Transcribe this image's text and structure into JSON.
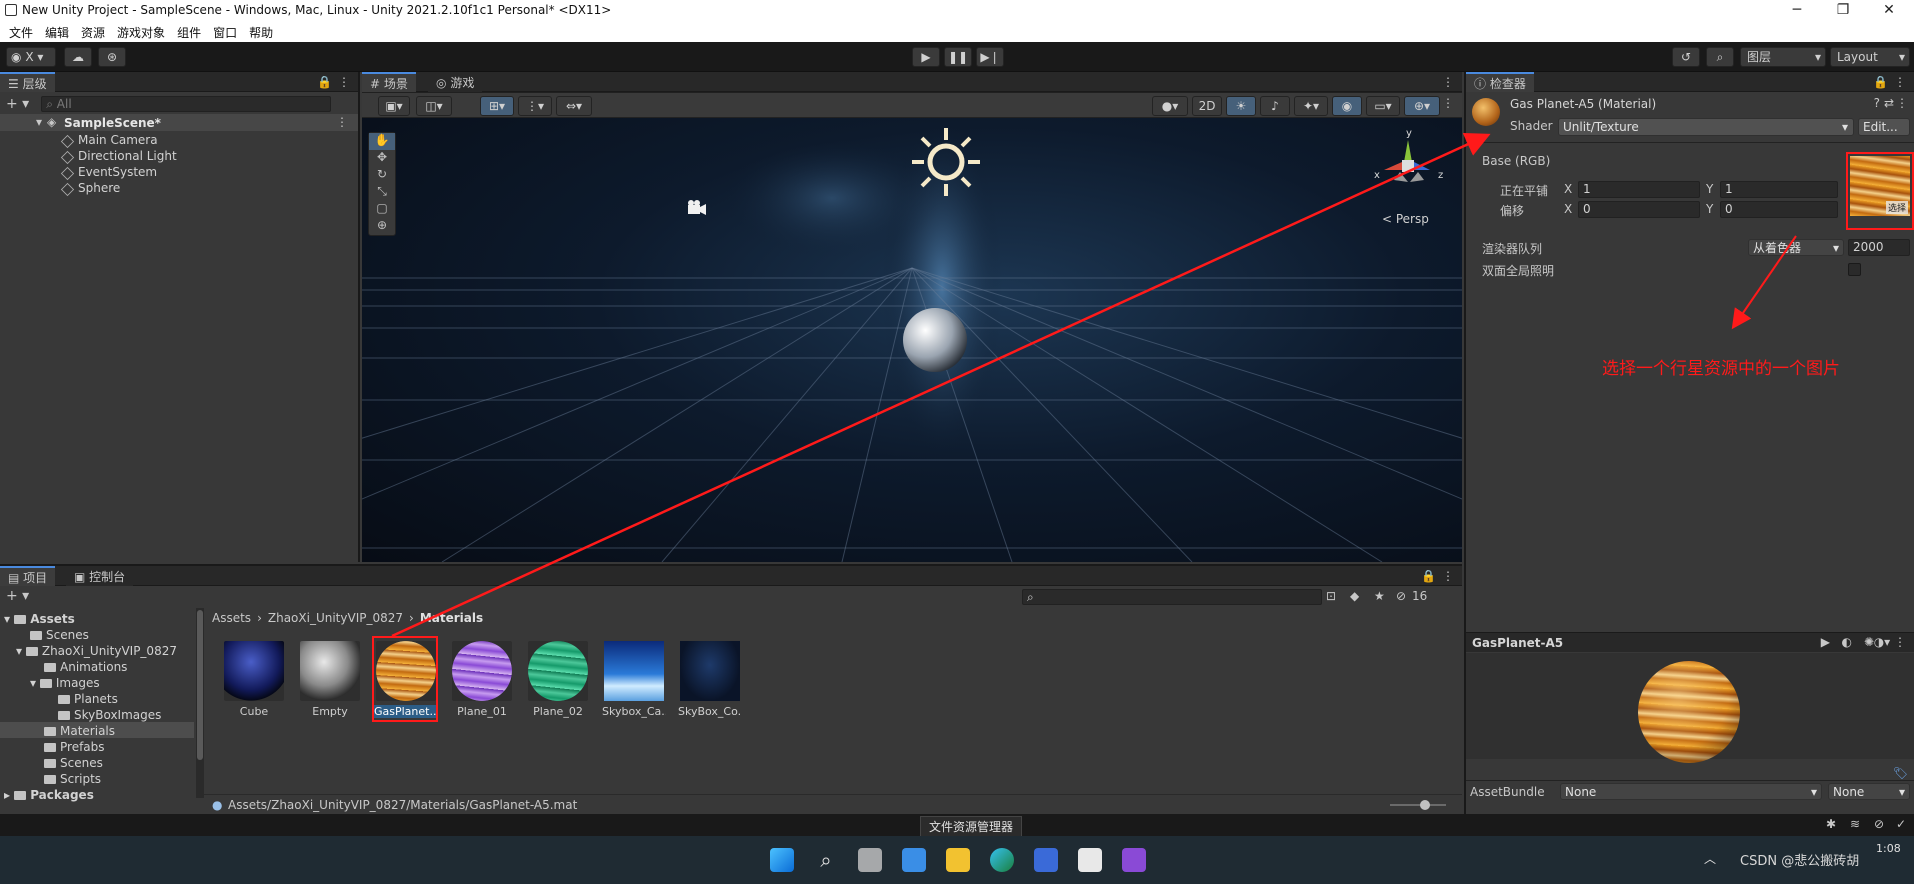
{
  "window": {
    "title": "New Unity Project - SampleScene - Windows, Mac, Linux - Unity 2021.2.10f1c1 Personal* <DX11>",
    "minimize": "─",
    "maximize": "❐",
    "close": "✕"
  },
  "menu": [
    "文件",
    "编辑",
    "资源",
    "游戏对象",
    "组件",
    "窗口",
    "帮助"
  ],
  "toolbar": {
    "account": "X",
    "layers": "图层",
    "layout": "Layout"
  },
  "hierarchy": {
    "tab": "层级",
    "search_placeholder": "All",
    "scene": "SampleScene*",
    "items": [
      "Main Camera",
      "Directional Light",
      "EventSystem",
      "Sphere"
    ]
  },
  "scene": {
    "tab_scene": "场景",
    "tab_game": "游戏",
    "btn_2d": "2D",
    "persp": "< Persp",
    "gizmo_y": "y",
    "gizmo_x": "x",
    "gizmo_z": "z"
  },
  "inspector": {
    "tab": "检查器",
    "material_name": "Gas Planet-A5 (Material)",
    "shader_label": "Shader",
    "shader_value": "Unlit/Texture",
    "edit_button": "Edit...",
    "base_label": "Base (RGB)",
    "tiling_label": "正在平铺",
    "offset_label": "偏移",
    "tiling_x": "1",
    "tiling_y": "1",
    "offset_x": "0",
    "offset_y": "0",
    "x_label": "X",
    "y_label": "Y",
    "select_label": "选择",
    "render_queue_label": "渲染器队列",
    "render_queue_mode": "从着色器",
    "render_queue_value": "2000",
    "double_sided_label": "双面全局照明",
    "annotation": "选择一个行星资源中的一个图片",
    "preview_title": "GasPlanet-A5",
    "assetbundle_label": "AssetBundle",
    "assetbundle_value": "None",
    "assetbundle_variant": "None"
  },
  "project": {
    "tab_project": "项目",
    "tab_console": "控制台",
    "count": "16",
    "breadcrumb": [
      "Assets",
      "ZhaoXi_UnityVIP_0827",
      "Materials"
    ],
    "tree": [
      {
        "label": "Assets",
        "bold": true
      },
      {
        "label": "Scenes"
      },
      {
        "label": "ZhaoXi_UnityVIP_0827"
      },
      {
        "label": "Animations"
      },
      {
        "label": "Images"
      },
      {
        "label": "Planets"
      },
      {
        "label": "SkyBoxImages"
      },
      {
        "label": "Materials"
      },
      {
        "label": "Prefabs"
      },
      {
        "label": "Scenes"
      },
      {
        "label": "Scripts"
      },
      {
        "label": "Packages",
        "bold": true
      }
    ],
    "assets": [
      "Cube",
      "Empty",
      "GasPlanet...",
      "Plane_01",
      "Plane_02",
      "Skybox_Ca...",
      "SkyBox_Co..."
    ],
    "path": "Assets/ZhaoXi_UnityVIP_0827/Materials/GasPlanet-A5.mat",
    "tooltip": "文件资源管理器"
  },
  "taskbar": {
    "clock": "1:08",
    "watermark": "CSDN @悲公搬砖胡"
  },
  "colors": {
    "accent": "#4a8adf",
    "annotation_red": "#ff1a1a",
    "selection": "#2c5d87"
  }
}
